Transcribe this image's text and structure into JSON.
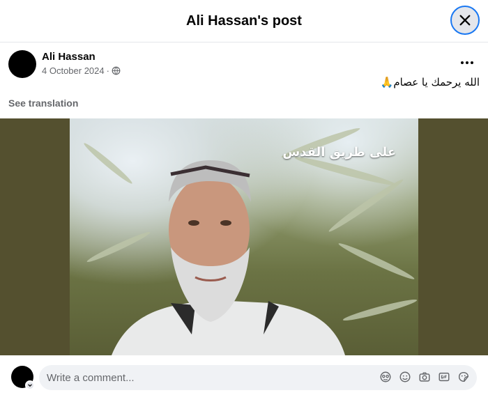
{
  "header": {
    "title": "Ali Hassan's post"
  },
  "post": {
    "author": "Ali Hassan",
    "date": "4 October 2024",
    "separator": "·",
    "audience_icon": "globe-icon",
    "text": "الله يرحمك يا عصام🙏",
    "see_translation": "See translation",
    "photo_caption": "على طريق القدس"
  },
  "composer": {
    "placeholder": "Write a comment...",
    "tools": [
      "avatar-sticker-icon",
      "emoji-icon",
      "camera-icon",
      "gif-icon",
      "sticker-icon"
    ]
  },
  "colors": {
    "accent": "#1877f2",
    "media_background": "#54502f",
    "secondary_text": "#65676b"
  }
}
